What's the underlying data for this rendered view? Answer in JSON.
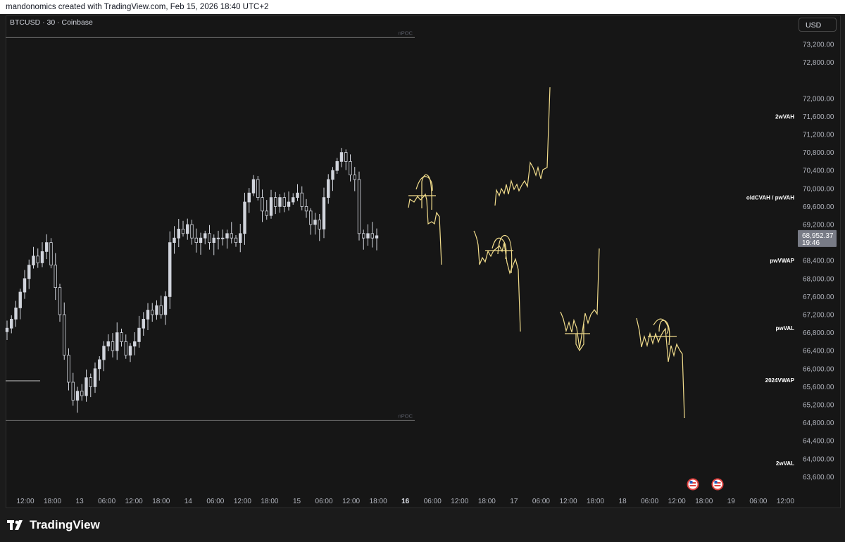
{
  "header": {
    "attribution": "mandonomics created with TradingView.com, Feb 15, 2026 18:40 UTC+2"
  },
  "symbol": "BTCUSD · 30 · Coinbase",
  "currency_button": "USD",
  "brand": "TradingView",
  "colors": {
    "background": "#161616",
    "candle": "#d1d4dc",
    "drawing": "#f2dd8c",
    "price_tag": "#787b86"
  },
  "chart_data": {
    "type": "candlestick",
    "ylim": [
      63300,
      73600
    ],
    "y_ticks": [
      "73,200.00",
      "72,800.00",
      "72,000.00",
      "71,600.00",
      "71,200.00",
      "70,800.00",
      "70,400.00",
      "70,000.00",
      "69,600.00",
      "69,200.00",
      "68,400.00",
      "68,000.00",
      "67,600.00",
      "67,200.00",
      "66,800.00",
      "66,400.00",
      "66,000.00",
      "65,600.00",
      "65,200.00",
      "64,800.00",
      "64,400.00",
      "64,000.00",
      "63,600.00"
    ],
    "x_ticks": [
      {
        "label": "12:00",
        "bold": false
      },
      {
        "label": "18:00",
        "bold": false
      },
      {
        "label": "13",
        "bold": false
      },
      {
        "label": "06:00",
        "bold": false
      },
      {
        "label": "12:00",
        "bold": false
      },
      {
        "label": "18:00",
        "bold": false
      },
      {
        "label": "14",
        "bold": false
      },
      {
        "label": "06:00",
        "bold": false
      },
      {
        "label": "12:00",
        "bold": false
      },
      {
        "label": "18:00",
        "bold": false
      },
      {
        "label": "15",
        "bold": false
      },
      {
        "label": "06:00",
        "bold": false
      },
      {
        "label": "12:00",
        "bold": false
      },
      {
        "label": "18:00",
        "bold": false
      },
      {
        "label": "16",
        "bold": true
      },
      {
        "label": "06:00",
        "bold": false
      },
      {
        "label": "12:00",
        "bold": false
      },
      {
        "label": "18:00",
        "bold": false
      },
      {
        "label": "17",
        "bold": false
      },
      {
        "label": "06:00",
        "bold": false
      },
      {
        "label": "12:00",
        "bold": false
      },
      {
        "label": "18:00",
        "bold": false
      },
      {
        "label": "18",
        "bold": false
      },
      {
        "label": "06:00",
        "bold": false
      },
      {
        "label": "12:00",
        "bold": false
      },
      {
        "label": "18:00",
        "bold": false
      },
      {
        "label": "19",
        "bold": false
      },
      {
        "label": "06:00",
        "bold": false
      },
      {
        "label": "12:00",
        "bold": false
      }
    ],
    "price_tag": {
      "price": "68,952.37",
      "timer": "19:46",
      "value": 68952.37
    },
    "levels": [
      {
        "label": "2wVAH",
        "value": 71600,
        "line": false
      },
      {
        "label": "oldCVAH / pwVAH",
        "value": 69800,
        "line": false
      },
      {
        "label": "pwVWAP",
        "value": 68400,
        "line": false
      },
      {
        "label": "pwVAL",
        "value": 66900,
        "line": false
      },
      {
        "label": "2024VWAP",
        "value": 65750,
        "line": false
      },
      {
        "label": "2wVAL",
        "value": 63900,
        "line": false
      }
    ],
    "npoc": [
      {
        "label": "nPOC",
        "value": 73350
      },
      {
        "label": "nPOC",
        "value": 64850
      }
    ],
    "closes": [
      66900,
      67100,
      67350,
      67700,
      68000,
      68300,
      68500,
      68350,
      68600,
      68800,
      68300,
      67800,
      67200,
      66300,
      65700,
      65300,
      65500,
      65400,
      65800,
      65600,
      66000,
      66200,
      66500,
      66600,
      66400,
      66800,
      66600,
      66300,
      66500,
      66600,
      66900,
      67100,
      67300,
      67200,
      67400,
      67200,
      67600,
      68800,
      68900,
      69100,
      69000,
      69200,
      68900,
      68800,
      68900,
      69000,
      68800,
      68900,
      68900,
      68900,
      69000,
      68900,
      68800,
      69000,
      69700,
      69900,
      70200,
      69800,
      69500,
      69400,
      69800,
      69600,
      69800,
      69600,
      69700,
      69800,
      69900,
      69600,
      69500,
      69200,
      69300,
      69100,
      69800,
      70200,
      70400,
      70600,
      70800,
      70600,
      70300,
      70200,
      69000,
      68900,
      69000,
      68900,
      68952
    ]
  }
}
